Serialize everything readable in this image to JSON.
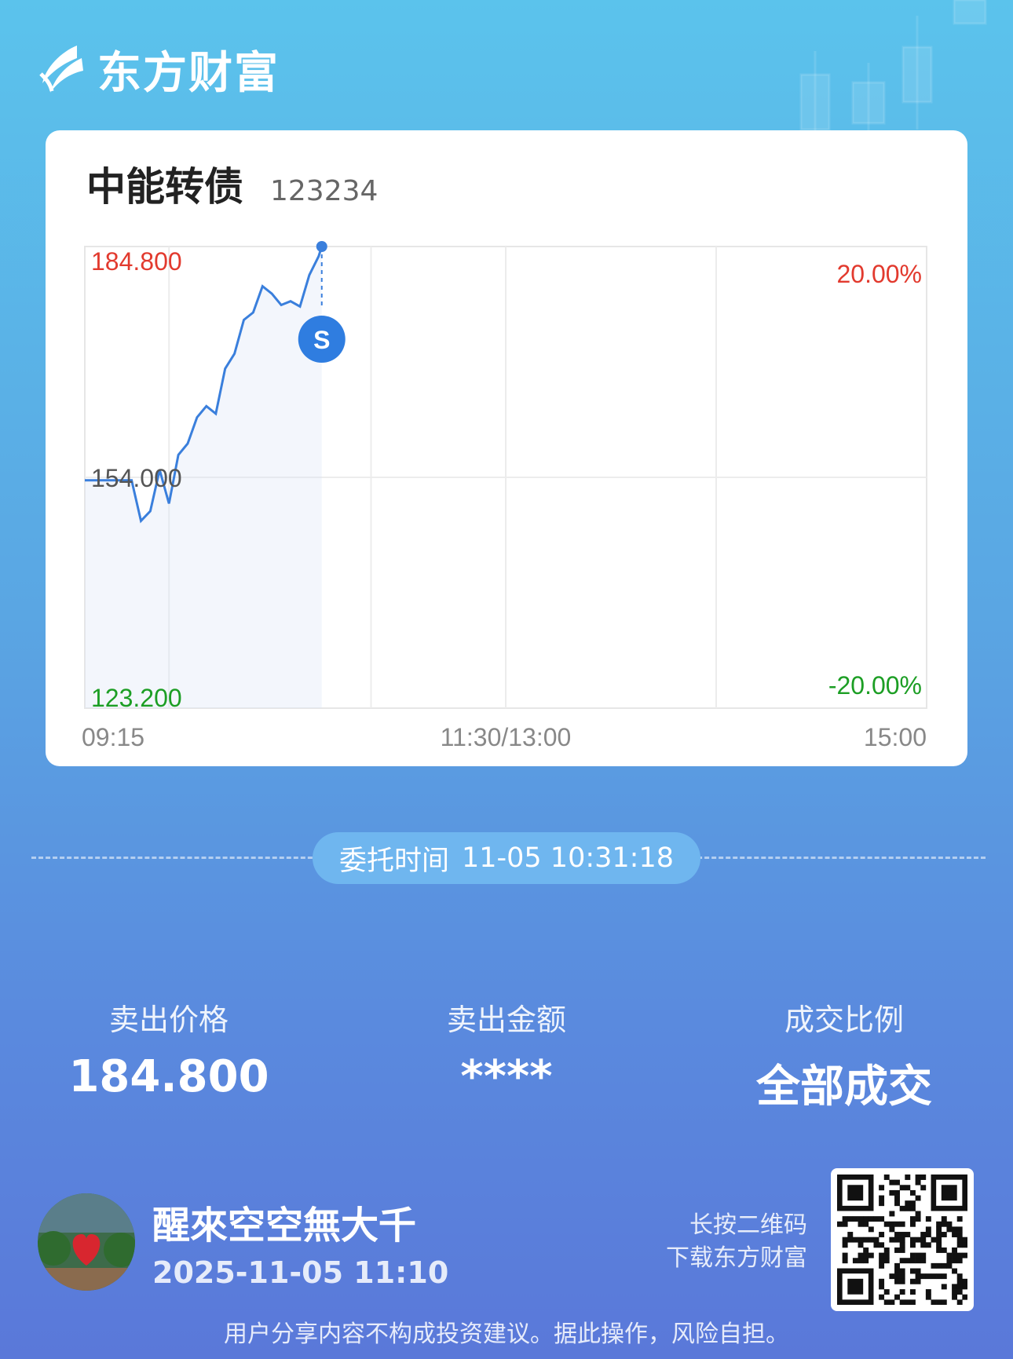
{
  "brand": {
    "name": "东方财富",
    "icon": "eastmoney-logo-icon"
  },
  "stock": {
    "name": "中能转债",
    "code": "123234"
  },
  "chart_data": {
    "type": "line",
    "title": "",
    "xlabel": "",
    "ylabel": "",
    "x_ticks": [
      "09:15",
      "11:30/13:00",
      "15:00"
    ],
    "y_left_ticks": [
      "184.800",
      "154.000",
      "123.200"
    ],
    "y_right_ticks": [
      "20.00%",
      "-20.00%"
    ],
    "ylim": [
      123.2,
      184.8
    ],
    "base_price": 154.0,
    "colors": {
      "up": "#e23a2e",
      "down": "#1c9e24",
      "mid": "#555555",
      "line": "#3a7fdc"
    },
    "marker": {
      "label": "S",
      "x": "10:31",
      "y": 184.8
    },
    "x": [
      "09:30",
      "09:33",
      "09:36",
      "09:39",
      "09:42",
      "09:45",
      "09:48",
      "09:51",
      "09:54",
      "09:57",
      "10:00",
      "10:03",
      "10:06",
      "10:09",
      "10:12",
      "10:15",
      "10:18",
      "10:21",
      "10:24",
      "10:27",
      "10:30",
      "10:31"
    ],
    "values": [
      153.6,
      148.2,
      149.5,
      155.0,
      150.5,
      157.0,
      158.5,
      162.0,
      163.5,
      162.5,
      168.5,
      170.5,
      175.0,
      176.0,
      179.5,
      178.5,
      177.0,
      177.5,
      176.8,
      181.0,
      183.5,
      184.8
    ]
  },
  "entrust": {
    "label": "委托时间",
    "time": "11-05 10:31:18"
  },
  "stats": [
    {
      "label": "卖出价格",
      "value": "184.800"
    },
    {
      "label": "卖出金额",
      "value": "****"
    },
    {
      "label": "成交比例",
      "value": "全部成交"
    }
  ],
  "user": {
    "name": "醒來空空無大千",
    "time": "2025-11-05 11:10"
  },
  "qr": {
    "hint_line1": "长按二维码",
    "hint_line2": "下载东方财富"
  },
  "disclaimer": "用户分享内容不构成投资建议。据此操作，风险自担。"
}
